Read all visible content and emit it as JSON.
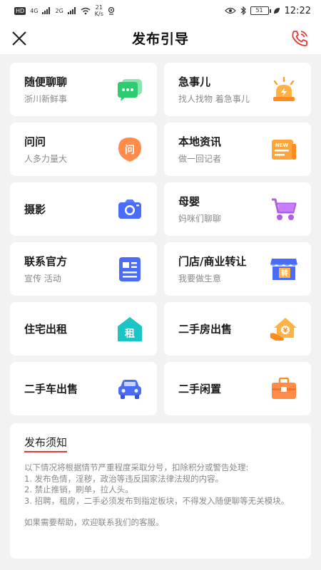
{
  "status_bar": {
    "hd": "HD",
    "sig1": "4G",
    "sig2": "2G",
    "speed_val": "21",
    "speed_unit": "K/s",
    "battery": "51",
    "time": "12:22"
  },
  "header": {
    "title": "发布引导"
  },
  "icons": {
    "back": "close-icon",
    "phone": "phone-icon"
  },
  "colors": {
    "accent_red": "#e53935",
    "green": "#2ecc71",
    "orange": "#ff9f2e",
    "blue": "#4a6cf7",
    "purple": "#b15ce8",
    "teal": "#1cc5c5"
  },
  "cards": [
    {
      "title": "随便聊聊",
      "subtitle": "浙川新鲜事",
      "icon": "chat-bubble-icon"
    },
    {
      "title": "急事儿",
      "subtitle": "找人找物 着急事儿",
      "icon": "alarm-light-icon"
    },
    {
      "title": "问问",
      "subtitle": "人多力量大",
      "icon": "question-bubble-icon",
      "icon_text": "问"
    },
    {
      "title": "本地资讯",
      "subtitle": "做一回记者",
      "icon": "news-icon",
      "icon_text": "NEW"
    },
    {
      "title": "摄影",
      "subtitle": "",
      "icon": "camera-icon"
    },
    {
      "title": "母婴",
      "subtitle": "妈咪们聊聊",
      "icon": "stroller-icon"
    },
    {
      "title": "联系官方",
      "subtitle": "宣传 活动",
      "icon": "document-icon"
    },
    {
      "title": "门店/商业转让",
      "subtitle": "我要做生意",
      "icon": "shop-icon",
      "icon_text": "转"
    },
    {
      "title": "住宅出租",
      "subtitle": "",
      "icon": "rent-house-icon",
      "icon_text": "租"
    },
    {
      "title": "二手房出售",
      "subtitle": "",
      "icon": "house-sale-icon",
      "icon_text": "¥"
    },
    {
      "title": "二手车出售",
      "subtitle": "",
      "icon": "car-icon"
    },
    {
      "title": "二手闲置",
      "subtitle": "",
      "icon": "briefcase-icon"
    }
  ],
  "notice": {
    "title": "发布须知",
    "intro": "以下情况将根据情节严重程度采取分号，扣除积分或警告处理:",
    "rules": [
      "1. 发布色情，淫秽，政治等违反国家法律法规的内容。",
      "2. 禁止推销，刷单，拉人头。",
      "3. 招聘，租房，二手必须发布到指定板块，不得发入随便聊等无关模块。"
    ],
    "help": "如果需要帮助，欢迎联系我们的客服。"
  }
}
